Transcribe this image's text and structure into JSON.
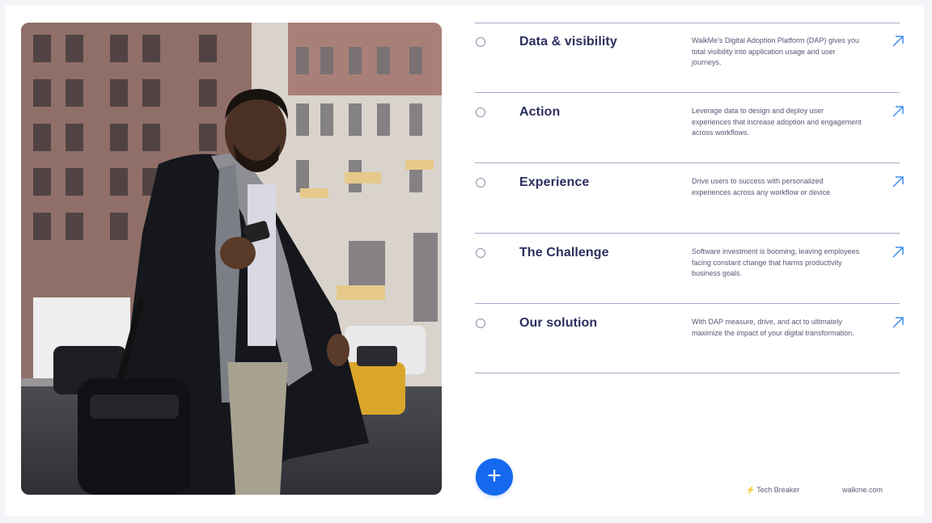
{
  "colors": {
    "accent": "#1469ee",
    "heading": "#2c2f5e",
    "divider": "#a6a9c7",
    "text_muted": "#555874"
  },
  "features": [
    {
      "title": "Data & visibility",
      "description": "WalkMe's Digital Adoption Platform (DAP) gives you total visibility into application usage and user journeys.",
      "icon": "arrow-up-right-icon"
    },
    {
      "title": "Action",
      "description": "Leverage data to design and deploy user experiences that increase adoption and engagement across workflows.",
      "icon": "arrow-up-right-icon"
    },
    {
      "title": "Experience",
      "description": "Drive users to success with personalized experiences across any workflow or device",
      "icon": "arrow-up-right-icon"
    },
    {
      "title": "The Challenge",
      "description": "Software investment is booming, leaving employees facing constant change that harms productivity business goals.",
      "icon": "arrow-up-right-icon"
    },
    {
      "title": "Our solution",
      "description": "With DAP measure, drive, and act to ultimately maximize the impact of your digital transformation.",
      "icon": "arrow-up-right-icon"
    }
  ],
  "add_button": {
    "symbol": "+",
    "icon": "plus-icon"
  },
  "footer": {
    "brand": "Tech Breaker",
    "brand_icon": "bolt-icon",
    "url": "walkme.com"
  }
}
